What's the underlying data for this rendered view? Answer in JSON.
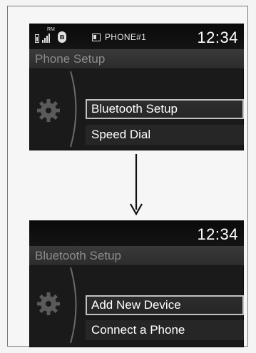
{
  "screen1": {
    "status": {
      "icons": [
        "battery-icon",
        "signal-icon",
        "bluetooth-icon",
        "phone-icon"
      ],
      "signal_label": "RM",
      "bt_glyph": "ʙ",
      "phone_name": "PHONE#1",
      "time": "12:34"
    },
    "title": "Phone Setup",
    "menu": {
      "items": [
        {
          "label": "Bluetooth Setup",
          "selected": true
        },
        {
          "label": "Speed Dial",
          "selected": false
        }
      ]
    }
  },
  "arrow": {
    "icon": "down-arrow-icon"
  },
  "screen2": {
    "status": {
      "time": "12:34"
    },
    "title": "Bluetooth Setup",
    "menu": {
      "items": [
        {
          "label": "Add New Device",
          "selected": true
        },
        {
          "label": "Connect a Phone",
          "selected": false
        }
      ]
    }
  },
  "colors": {
    "screen_bg": "#1a1a1a",
    "title_text": "#8c8c8c",
    "highlight_border": "#c2c2c2",
    "text": "#ffffff"
  }
}
